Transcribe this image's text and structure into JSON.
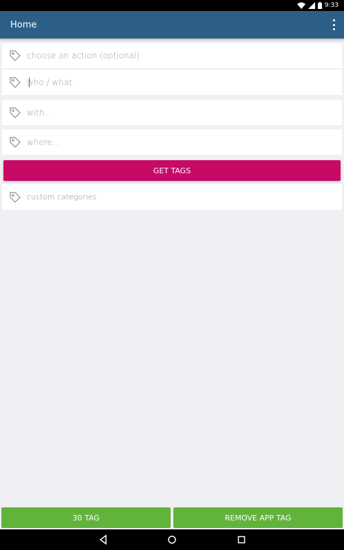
{
  "status_bar": {
    "time": "9:33",
    "icons": [
      "wifi-icon",
      "cell-signal-icon",
      "battery-icon"
    ]
  },
  "app_bar": {
    "title": "Home",
    "menu_icon": "overflow-menu-icon"
  },
  "fields": [
    {
      "icon": "tag-icon",
      "placeholder": "choose an action (optional)"
    },
    {
      "icon": "tag-icon",
      "placeholder": "who / what",
      "focused": true
    },
    {
      "icon": "tag-icon",
      "placeholder": "with..."
    },
    {
      "icon": "tag-icon",
      "placeholder": "where..."
    }
  ],
  "get_tags_button": {
    "label": "GET TAGS"
  },
  "custom_categories": {
    "icon": "tag-icon",
    "label": "custom categories"
  },
  "bottom_buttons": {
    "left": {
      "label": "30 TAG"
    },
    "right": {
      "label": "REMOVE APP TAG"
    }
  },
  "nav_bar": {
    "icons": [
      "back-icon",
      "home-icon",
      "recents-icon"
    ]
  },
  "colors": {
    "app_bar": "#2d5f86",
    "accent_button": "#c70a65",
    "bottom_button": "#61b33c",
    "background": "#efeff4"
  }
}
